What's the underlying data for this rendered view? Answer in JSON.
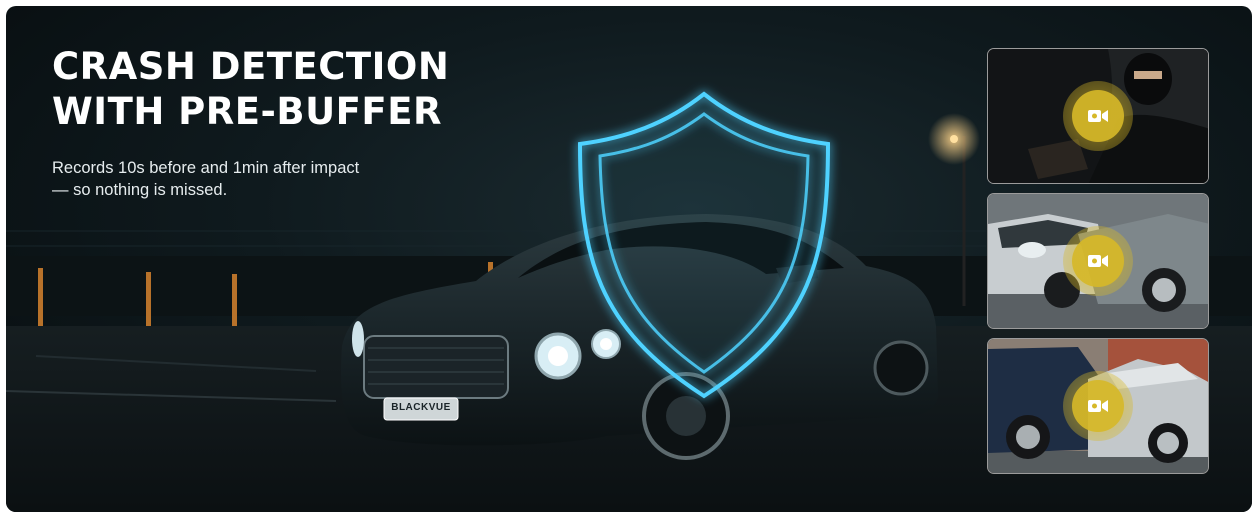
{
  "banner": {
    "headline_line1": "CRASH DETECTION",
    "headline_line2": "WITH PRE-BUFFER",
    "subhead_line1": "Records 10s before and 1min after impact",
    "subhead_line2": "— so nothing is missed.",
    "badge_text": "BLACKVUE"
  },
  "thumbnails": [
    {
      "scene": "Masked person breaking into a car at night",
      "icon": "video-record-icon"
    },
    {
      "scene": "Silver car dented side collision",
      "icon": "video-record-icon"
    },
    {
      "scene": "Dark car rear-ending a silver car",
      "icon": "video-record-icon"
    }
  ],
  "colors": {
    "background": "#0f1a1e",
    "shield_glow": "#4fd2ff",
    "record_badge": "#d6b828",
    "text": "#ffffff"
  }
}
